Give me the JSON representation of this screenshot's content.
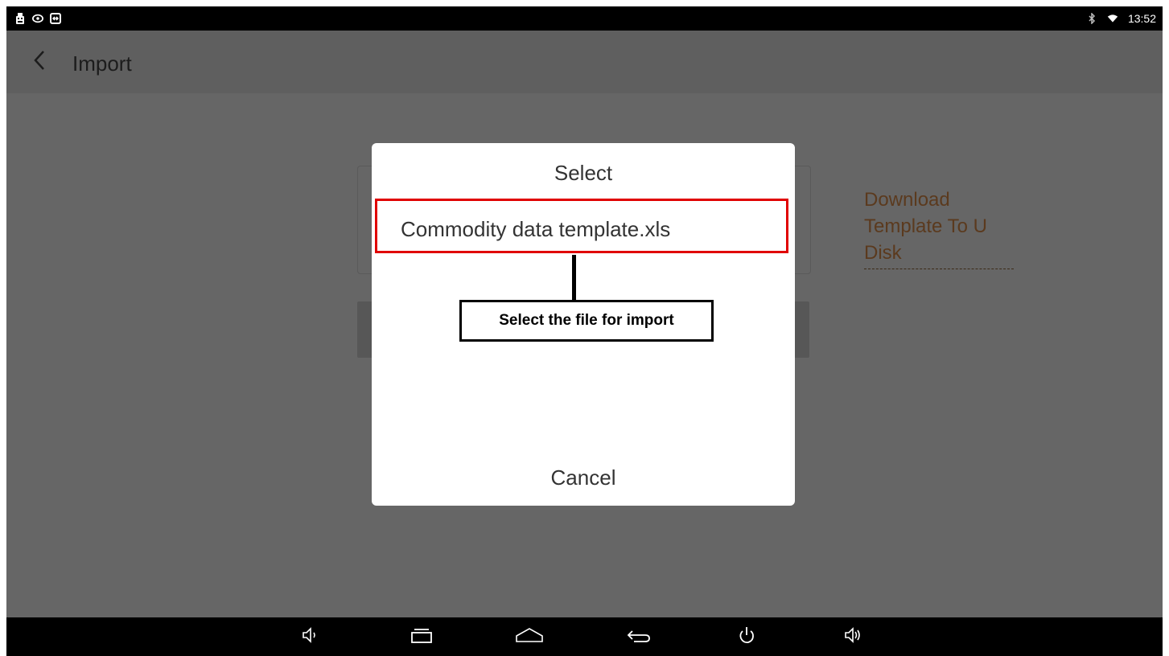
{
  "status_bar": {
    "time": "13:52",
    "left_icons": [
      "usb-icon",
      "eye-icon",
      "remote-icon"
    ],
    "right_icons": [
      "bluetooth-icon",
      "wifi-icon"
    ]
  },
  "action_bar": {
    "back_icon": "chevron-left-icon",
    "title": "Import"
  },
  "download_link": {
    "label": "Download Template To U Disk",
    "color": "#5b3a1e"
  },
  "dialog": {
    "title": "Select",
    "items": [
      {
        "label": "Commodity data template.xls"
      }
    ],
    "cancel_label": "Cancel"
  },
  "annotation": {
    "text": "Select the file for import",
    "highlight_color": "#e00000"
  },
  "nav_bar": {
    "buttons": [
      "volume-down-icon",
      "recent-apps-icon",
      "home-icon",
      "back-icon",
      "power-icon",
      "volume-up-icon"
    ]
  }
}
